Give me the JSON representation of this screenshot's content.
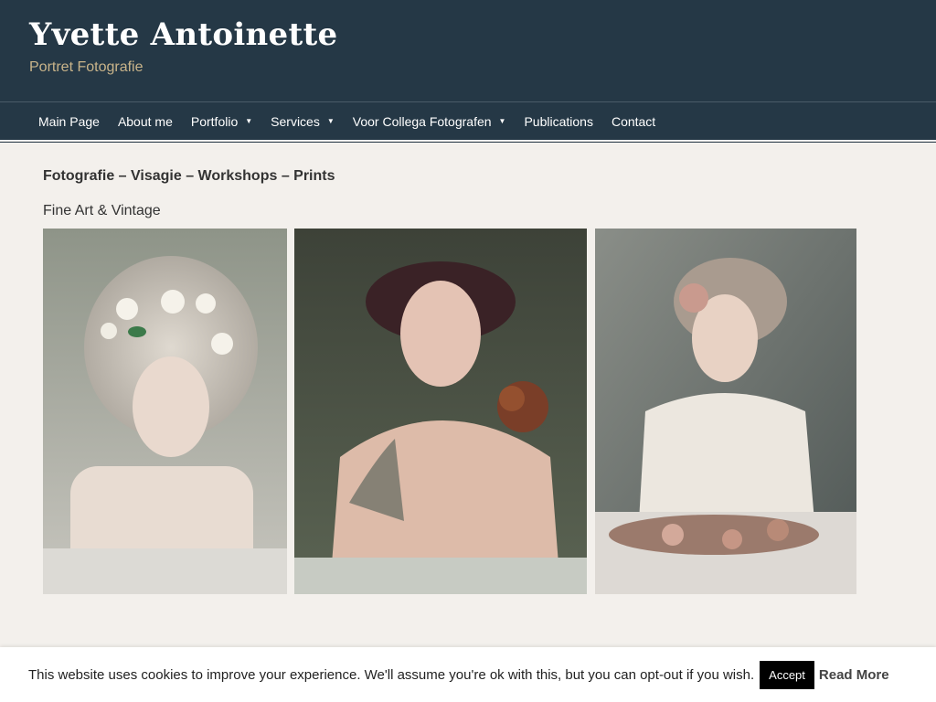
{
  "header": {
    "title": "Yvette Antoinette",
    "tagline": "Portret Fotografie"
  },
  "nav": {
    "items": [
      {
        "label": "Main Page",
        "has_dropdown": false
      },
      {
        "label": "About me",
        "has_dropdown": false
      },
      {
        "label": "Portfolio",
        "has_dropdown": true
      },
      {
        "label": "Services",
        "has_dropdown": true
      },
      {
        "label": "Voor Collega Fotografen",
        "has_dropdown": true
      },
      {
        "label": "Publications",
        "has_dropdown": false
      },
      {
        "label": "Contact",
        "has_dropdown": false
      }
    ]
  },
  "main": {
    "headline": "Fotografie – Visagie – Workshops – Prints",
    "subline": "Fine Art & Vintage"
  },
  "cookie": {
    "text": "This website uses cookies to improve your experience. We'll assume you're ok with this, but you can opt-out if you wish.",
    "accept_label": "Accept",
    "read_more_label": "Read More"
  },
  "colors": {
    "header_bg": "#253846",
    "tagline": "#c9b48a",
    "page_bg": "#f3f0ec"
  }
}
